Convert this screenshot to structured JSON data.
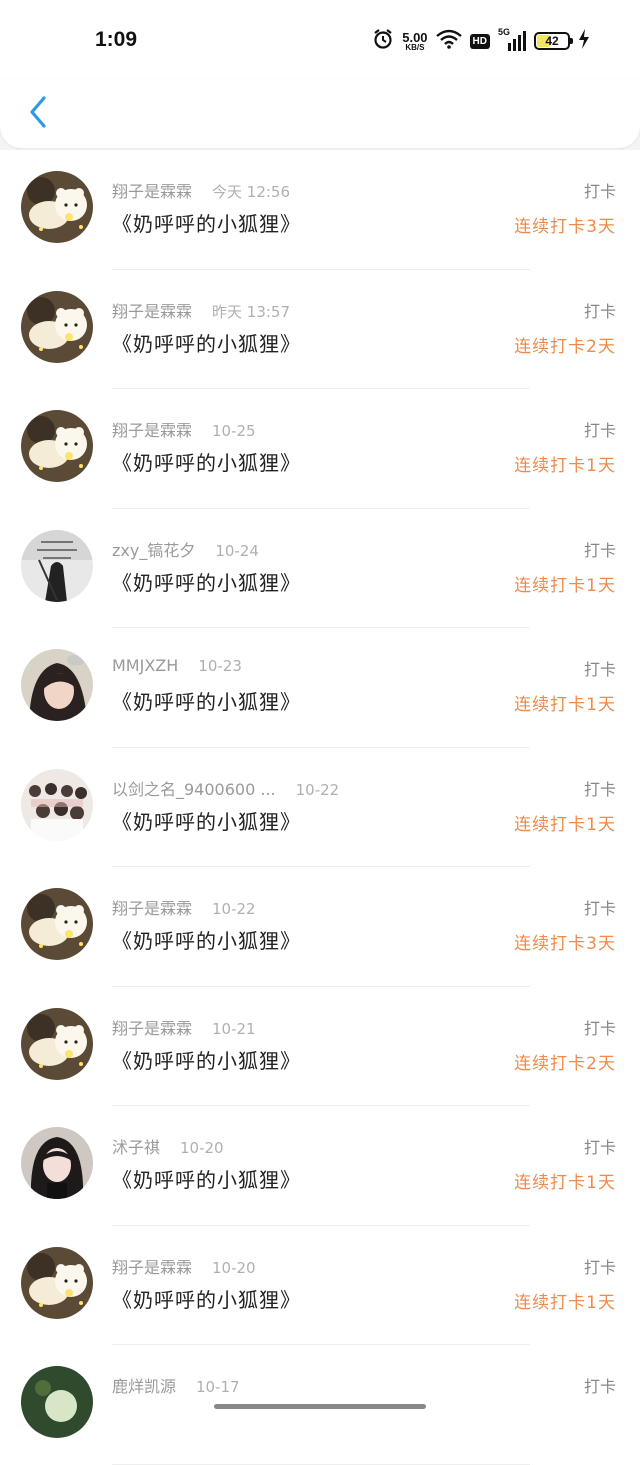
{
  "status_bar": {
    "time": "1:09",
    "net_speed_value": "5.00",
    "net_speed_unit": "KB/S",
    "hd": "HD",
    "network": "5G",
    "battery": "42"
  },
  "entries": [
    {
      "user": "翔子是霖霖",
      "date": "今天 12:56",
      "title": "《奶呼呼的小狐狸》",
      "checkin": "打卡",
      "streak": "连续打卡3天",
      "avatar": "bear"
    },
    {
      "user": "翔子是霖霖",
      "date": "昨天 13:57",
      "title": "《奶呼呼的小狐狸》",
      "checkin": "打卡",
      "streak": "连续打卡2天",
      "avatar": "bear"
    },
    {
      "user": "翔子是霖霖",
      "date": "10-25",
      "title": "《奶呼呼的小狐狸》",
      "checkin": "打卡",
      "streak": "连续打卡1天",
      "avatar": "bear"
    },
    {
      "user": "zxy_镐花夕",
      "date": "10-24",
      "title": "《奶呼呼的小狐狸》",
      "checkin": "打卡",
      "streak": "连续打卡1天",
      "avatar": "dark"
    },
    {
      "user": "MMJXZH",
      "date": "10-23",
      "title": "《奶呼呼的小狐狸》",
      "checkin": "打卡",
      "streak": "连续打卡1天",
      "avatar": "girl"
    },
    {
      "user": "以剑之名_9400600 ...",
      "date": "10-22",
      "title": "《奶呼呼的小狐狸》",
      "checkin": "打卡",
      "streak": "连续打卡1天",
      "avatar": "group"
    },
    {
      "user": "翔子是霖霖",
      "date": "10-22",
      "title": "《奶呼呼的小狐狸》",
      "checkin": "打卡",
      "streak": "连续打卡3天",
      "avatar": "bear"
    },
    {
      "user": "翔子是霖霖",
      "date": "10-21",
      "title": "《奶呼呼的小狐狸》",
      "checkin": "打卡",
      "streak": "连续打卡2天",
      "avatar": "bear"
    },
    {
      "user": "沭子祺",
      "date": "10-20",
      "title": "《奶呼呼的小狐狸》",
      "checkin": "打卡",
      "streak": "连续打卡1天",
      "avatar": "girl2"
    },
    {
      "user": "翔子是霖霖",
      "date": "10-20",
      "title": "《奶呼呼的小狐狸》",
      "checkin": "打卡",
      "streak": "连续打卡1天",
      "avatar": "bear"
    },
    {
      "user": "鹿烊凯源",
      "date": "10-17",
      "title": "",
      "checkin": "打卡",
      "streak": "",
      "avatar": "green"
    }
  ],
  "colors": {
    "accent": "#2b9be8",
    "streak": "#ef8a4a"
  }
}
